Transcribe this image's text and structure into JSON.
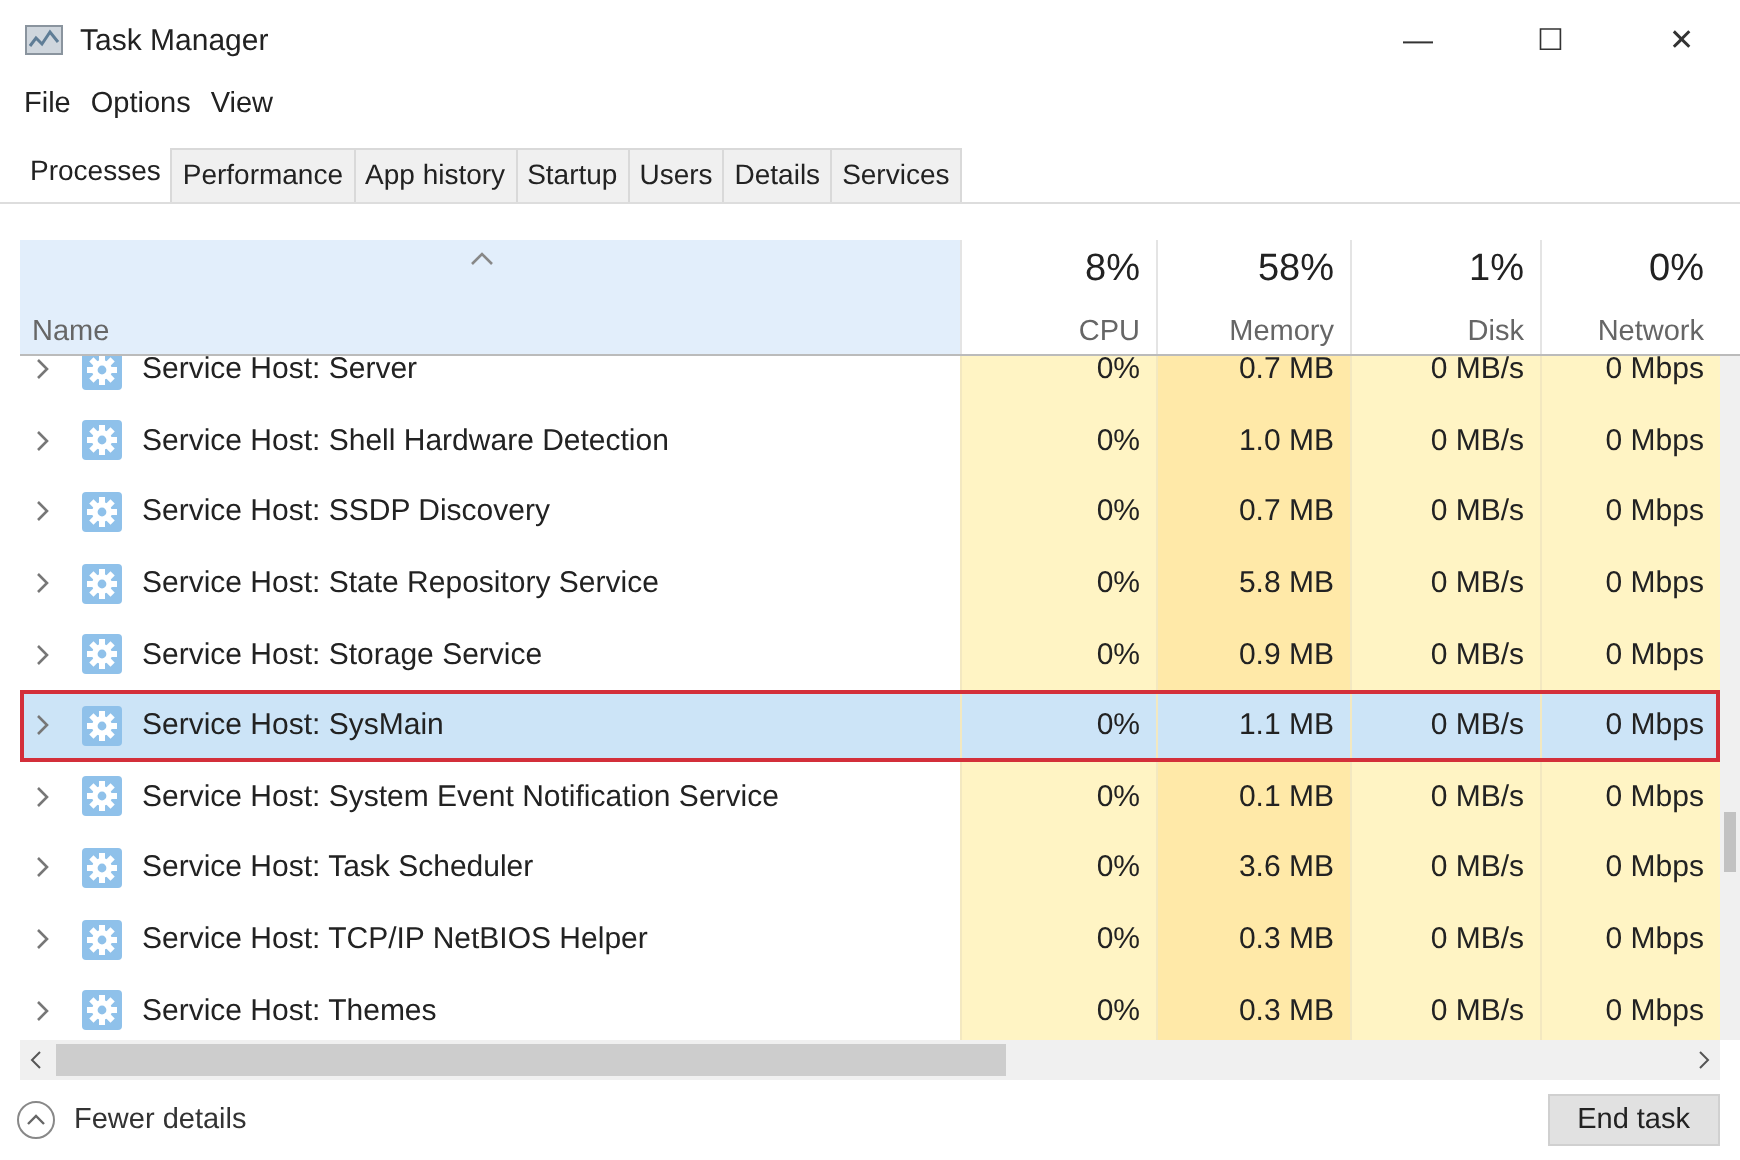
{
  "window": {
    "title": "Task Manager",
    "controls": [
      "—",
      "☐",
      "✕"
    ]
  },
  "menu": [
    "File",
    "Options",
    "View"
  ],
  "tabs": [
    {
      "label": "Processes",
      "selected": true
    },
    {
      "label": "Performance",
      "selected": false
    },
    {
      "label": "App history",
      "selected": false
    },
    {
      "label": "Startup",
      "selected": false
    },
    {
      "label": "Users",
      "selected": false
    },
    {
      "label": "Details",
      "selected": false
    },
    {
      "label": "Services",
      "selected": false
    }
  ],
  "table": {
    "columns": [
      {
        "label": "Name",
        "sorted": true
      },
      {
        "percent": "8%",
        "label": "CPU",
        "sorted": false
      },
      {
        "percent": "58%",
        "label": "Memory",
        "sorted": false
      },
      {
        "percent": "1%",
        "label": "Disk",
        "sorted": false
      },
      {
        "percent": "0%",
        "label": "Network",
        "sorted": false
      }
    ],
    "rows": [
      {
        "name": "Service Host: Server",
        "cpu": "0%",
        "memory": "0.7 MB",
        "disk": "0 MB/s",
        "network": "0 Mbps",
        "selected": false,
        "outlined": false
      },
      {
        "name": "Service Host: Shell Hardware Detection",
        "cpu": "0%",
        "memory": "1.0 MB",
        "disk": "0 MB/s",
        "network": "0 Mbps",
        "selected": false,
        "outlined": false
      },
      {
        "name": "Service Host: SSDP Discovery",
        "cpu": "0%",
        "memory": "0.7 MB",
        "disk": "0 MB/s",
        "network": "0 Mbps",
        "selected": false,
        "outlined": false
      },
      {
        "name": "Service Host: State Repository Service",
        "cpu": "0%",
        "memory": "5.8 MB",
        "disk": "0 MB/s",
        "network": "0 Mbps",
        "selected": false,
        "outlined": false
      },
      {
        "name": "Service Host: Storage Service",
        "cpu": "0%",
        "memory": "0.9 MB",
        "disk": "0 MB/s",
        "network": "0 Mbps",
        "selected": false,
        "outlined": false
      },
      {
        "name": "Service Host: SysMain",
        "cpu": "0%",
        "memory": "1.1 MB",
        "disk": "0 MB/s",
        "network": "0 Mbps",
        "selected": true,
        "outlined": true
      },
      {
        "name": "Service Host: System Event Notification Service",
        "cpu": "0%",
        "memory": "0.1 MB",
        "disk": "0 MB/s",
        "network": "0 Mbps",
        "selected": false,
        "outlined": false
      },
      {
        "name": "Service Host: Task Scheduler",
        "cpu": "0%",
        "memory": "3.6 MB",
        "disk": "0 MB/s",
        "network": "0 Mbps",
        "selected": false,
        "outlined": false
      },
      {
        "name": "Service Host: TCP/IP NetBIOS Helper",
        "cpu": "0%",
        "memory": "0.3 MB",
        "disk": "0 MB/s",
        "network": "0 Mbps",
        "selected": false,
        "outlined": false
      },
      {
        "name": "Service Host: Themes",
        "cpu": "0%",
        "memory": "0.3 MB",
        "disk": "0 MB/s",
        "network": "0 Mbps",
        "selected": false,
        "outlined": false
      }
    ]
  },
  "footer": {
    "details_toggle": "Fewer details",
    "button": "End task"
  }
}
